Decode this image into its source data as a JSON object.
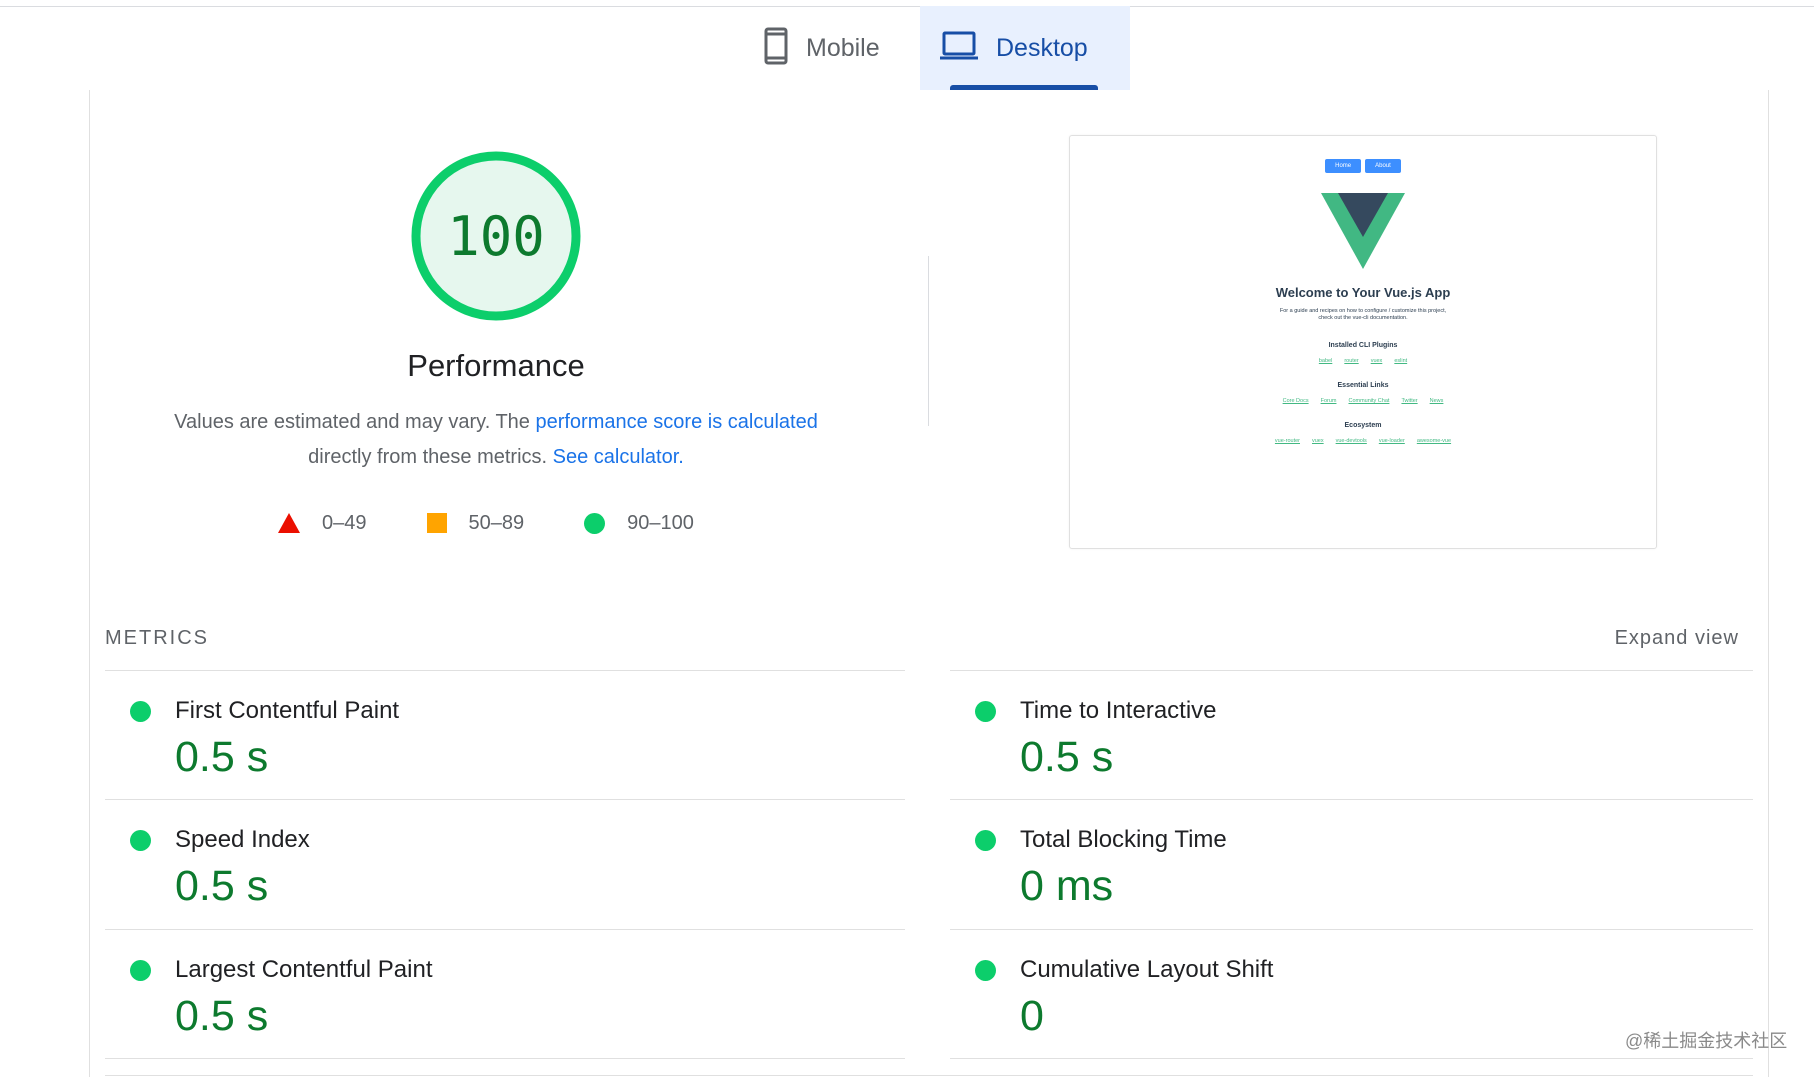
{
  "tabs": {
    "mobile": {
      "label": "Mobile",
      "icon": "smartphone-icon"
    },
    "desktop": {
      "label": "Desktop",
      "icon": "laptop-icon",
      "selected": true
    }
  },
  "gauge": {
    "score": "100",
    "title": "Performance",
    "color": "#0cce6b"
  },
  "description": {
    "text1": "Values are estimated and may vary. The ",
    "link1": "performance score is calculated",
    "text2": "directly from these metrics. ",
    "link2": "See calculator."
  },
  "legend": [
    {
      "range": "0–49",
      "color": "#eb0f00"
    },
    {
      "range": "50–89",
      "color": "#ffa400"
    },
    {
      "range": "90–100",
      "color": "#0cce6b"
    }
  ],
  "screenshot": {
    "nav": [
      "Home",
      "About"
    ],
    "title": "Welcome to Your Vue.js App",
    "subtitle_line1": "For a guide and recipes on how to configure / customize this project,",
    "subtitle_line2": "check out the vue-cli documentation.",
    "sections": [
      {
        "heading": "Installed CLI Plugins",
        "links": [
          "babel",
          "router",
          "vuex",
          "eslint"
        ]
      },
      {
        "heading": "Essential Links",
        "links": [
          "Core Docs",
          "Forum",
          "Community Chat",
          "Twitter",
          "News"
        ]
      },
      {
        "heading": "Ecosystem",
        "links": [
          "vue-router",
          "vuex",
          "vue-devtools",
          "vue-loader",
          "awesome-vue"
        ]
      }
    ]
  },
  "metrics": {
    "heading": "METRICS",
    "expand": "Expand view",
    "items": [
      {
        "name": "First Contentful Paint",
        "value": "0.5 s"
      },
      {
        "name": "Time to Interactive",
        "value": "0.5 s"
      },
      {
        "name": "Speed Index",
        "value": "0.5 s"
      },
      {
        "name": "Total Blocking Time",
        "value": "0 ms"
      },
      {
        "name": "Largest Contentful Paint",
        "value": "0.5 s"
      },
      {
        "name": "Cumulative Layout Shift",
        "value": "0"
      }
    ]
  },
  "watermark": "@稀土掘金技术社区"
}
